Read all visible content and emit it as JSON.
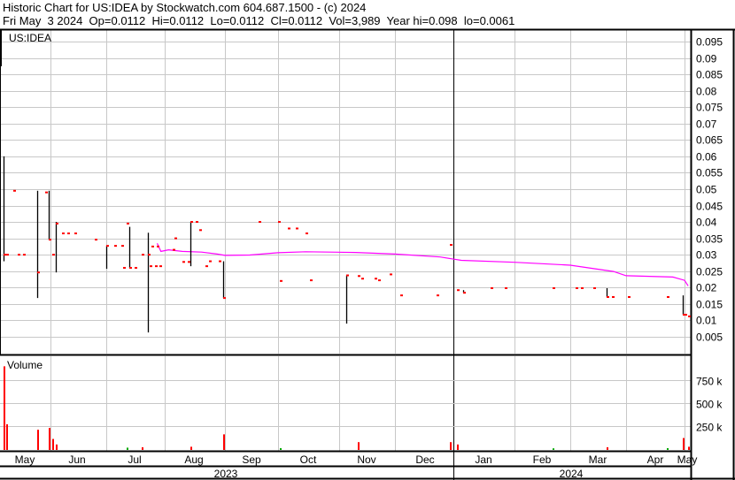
{
  "header": {
    "title": "Historic Chart for US:IDEA by Stockwatch.com 604.687.1500 - (c) 2024",
    "quote": "Fri May  3 2024  Op=0.0112  Hi=0.0112  Lo=0.0112  Cl=0.0112  Vol=3,989  Year hi=0.098  lo=0.0061"
  },
  "colors": {
    "bar": "#000000",
    "close_tick": "#ff0000",
    "moving_average": "#ff00ff",
    "volume_up": "#ff0000",
    "volume_other": "#00aa00",
    "grid": "#c8c8c8"
  },
  "chart_data": [
    {
      "type": "ohlc",
      "title": "US:IDEA",
      "ylim": [
        0,
        0.1
      ],
      "yticks": [
        "0.005",
        "0.01",
        "0.015",
        "0.02",
        "0.025",
        "0.03",
        "0.035",
        "0.04",
        "0.045",
        "0.05",
        "0.055",
        "0.06",
        "0.065",
        "0.07",
        "0.075",
        "0.08",
        "0.085",
        "0.09",
        "0.095"
      ],
      "xticks": [
        "May",
        "Jun",
        "Jul",
        "Aug",
        "Sep",
        "Oct",
        "Nov",
        "Dec",
        "Jan",
        "Feb",
        "Mar",
        "Apr",
        "May"
      ],
      "years": [
        "2023",
        "2024"
      ],
      "bars": [
        [
          "2023-05-03",
          0.06,
          0.028,
          0.03
        ],
        [
          "2023-05-05",
          0.03,
          0.03,
          0.03
        ],
        [
          "2023-05-09",
          0.0495,
          0.0495,
          0.0495
        ],
        [
          "2023-05-12",
          0.03,
          0.03,
          0.03
        ],
        [
          "2023-05-15",
          0.03,
          0.03,
          0.03
        ],
        [
          "2023-05-24",
          0.0495,
          0.0168,
          0.0246
        ],
        [
          "2023-05-29",
          0.049,
          0.049,
          0.049
        ],
        [
          "2023-05-31",
          0.0495,
          0.0346,
          0.0346
        ],
        [
          "2023-06-02",
          0.03,
          0.03,
          0.03
        ],
        [
          "2023-06-04",
          0.04,
          0.0246,
          0.0395
        ],
        [
          "2023-06-07",
          0.0365,
          0.0365,
          0.0365
        ],
        [
          "2023-06-10",
          0.0365,
          0.0365,
          0.0365
        ],
        [
          "2023-06-14",
          0.0365,
          0.0365,
          0.0365
        ],
        [
          "2023-06-25",
          0.0346,
          0.0346,
          0.0346
        ],
        [
          "2023-07-01",
          0.0327,
          0.0257,
          0.0327
        ],
        [
          "2023-07-05",
          0.0327,
          0.0327,
          0.0327
        ],
        [
          "2023-07-09",
          0.0327,
          0.0327,
          0.0327
        ],
        [
          "2023-07-10",
          0.026,
          0.026,
          0.026
        ],
        [
          "2023-07-12",
          0.0395,
          0.0395,
          0.0395
        ],
        [
          "2023-07-13",
          0.0385,
          0.026,
          0.026
        ],
        [
          "2023-07-16",
          0.026,
          0.026,
          0.026
        ],
        [
          "2023-07-20",
          0.03,
          0.03,
          0.03
        ],
        [
          "2023-07-23",
          0.0367,
          0.0063,
          0.03
        ],
        [
          "2023-07-24",
          0.0265,
          0.0265,
          0.0265
        ],
        [
          "2023-07-25",
          0.0325,
          0.0325,
          0.0325
        ],
        [
          "2023-07-27",
          0.0265,
          0.0265,
          0.0265
        ],
        [
          "2023-07-28",
          0.0325,
          0.0325,
          0.0325
        ],
        [
          "2023-07-29",
          0.0265,
          0.0265,
          0.0265
        ],
        [
          "2023-08-05",
          0.0315,
          0.0315,
          0.0315
        ],
        [
          "2023-08-06",
          0.035,
          0.035,
          0.035
        ],
        [
          "2023-08-10",
          0.0278,
          0.0278,
          0.0278
        ],
        [
          "2023-08-13",
          0.0278,
          0.0278,
          0.0278
        ],
        [
          "2023-08-14",
          0.04,
          0.0265,
          0.04
        ],
        [
          "2023-08-17",
          0.04,
          0.04,
          0.04
        ],
        [
          "2023-08-19",
          0.0375,
          0.0375,
          0.0375
        ],
        [
          "2023-08-22",
          0.0265,
          0.0265,
          0.0265
        ],
        [
          "2023-08-24",
          0.028,
          0.028,
          0.028
        ],
        [
          "2023-08-29",
          0.028,
          0.028,
          0.028
        ],
        [
          "2023-08-31",
          0.028,
          0.0168,
          0.0168
        ],
        [
          "2023-09-20",
          0.04,
          0.04,
          0.04
        ],
        [
          "2023-10-01",
          0.04,
          0.04,
          0.04
        ],
        [
          "2023-10-02",
          0.022,
          0.022,
          0.022
        ],
        [
          "2023-10-06",
          0.038,
          0.038,
          0.038
        ],
        [
          "2023-10-10",
          0.038,
          0.038,
          0.038
        ],
        [
          "2023-10-15",
          0.0365,
          0.0365,
          0.0365
        ],
        [
          "2023-10-17",
          0.0222,
          0.0222,
          0.0222
        ],
        [
          "2023-11-05",
          0.0237,
          0.009,
          0.0237
        ],
        [
          "2023-11-11",
          0.0235,
          0.0235,
          0.0235
        ],
        [
          "2023-11-13",
          0.0227,
          0.0227,
          0.0227
        ],
        [
          "2023-11-20",
          0.0227,
          0.0227,
          0.0227
        ],
        [
          "2023-11-22",
          0.0222,
          0.0222,
          0.0222
        ],
        [
          "2023-11-28",
          0.024,
          0.024,
          0.024
        ],
        [
          "2023-12-04",
          0.0176,
          0.0176,
          0.0176
        ],
        [
          "2023-12-23",
          0.0176,
          0.0176,
          0.0176
        ],
        [
          "2023-12-30",
          0.033,
          0.033,
          0.033
        ],
        [
          "2024-01-03",
          0.0192,
          0.0192,
          0.0192
        ],
        [
          "2024-01-06",
          0.0192,
          0.0184,
          0.0184
        ],
        [
          "2024-01-20",
          0.0198,
          0.0198,
          0.0198
        ],
        [
          "2024-01-27",
          0.0198,
          0.0198,
          0.0198
        ],
        [
          "2024-02-21",
          0.0198,
          0.0198,
          0.0198
        ],
        [
          "2024-03-04",
          0.0198,
          0.0198,
          0.0198
        ],
        [
          "2024-03-07",
          0.0198,
          0.0198,
          0.0198
        ],
        [
          "2024-03-14",
          0.0198,
          0.0198,
          0.0198
        ],
        [
          "2024-03-21",
          0.0198,
          0.0171,
          0.0171
        ],
        [
          "2024-03-24",
          0.0171,
          0.0171,
          0.0171
        ],
        [
          "2024-04-02",
          0.0171,
          0.0171,
          0.0171
        ],
        [
          "2024-04-22",
          0.0171,
          0.0171,
          0.0171
        ],
        [
          "2024-04-30",
          0.0176,
          0.0117,
          0.0117
        ],
        [
          "2024-05-01",
          0.0117,
          0.0117,
          0.0117
        ],
        [
          "2024-05-03",
          0.0112,
          0.0112,
          0.0112
        ]
      ],
      "moving_average": [
        [
          "2023-07-28",
          0.0335
        ],
        [
          "2023-07-30",
          0.031
        ],
        [
          "2023-08-03",
          0.0315
        ],
        [
          "2023-08-10",
          0.031
        ],
        [
          "2023-08-20",
          0.0308
        ],
        [
          "2023-08-28",
          0.0302
        ],
        [
          "2023-09-01",
          0.0298
        ],
        [
          "2023-09-15",
          0.0299
        ],
        [
          "2023-10-01",
          0.0306
        ],
        [
          "2023-10-15",
          0.0309
        ],
        [
          "2023-11-10",
          0.0307
        ],
        [
          "2023-12-01",
          0.0302
        ],
        [
          "2023-12-25",
          0.0293
        ],
        [
          "2024-01-05",
          0.0283
        ],
        [
          "2024-02-01",
          0.0277
        ],
        [
          "2024-03-01",
          0.0268
        ],
        [
          "2024-03-25",
          0.0249
        ],
        [
          "2024-04-01",
          0.0236
        ],
        [
          "2024-04-25",
          0.0232
        ],
        [
          "2024-05-01",
          0.0222
        ],
        [
          "2024-05-03",
          0.0205
        ]
      ]
    },
    {
      "type": "bar",
      "title": "Volume",
      "ylim": [
        0,
        950000
      ],
      "yticks": [
        "250 k",
        "500 k",
        "750 k"
      ],
      "values": [
        [
          "2023-05-03",
          900000,
          "up"
        ],
        [
          "2023-05-05",
          270000,
          "up"
        ],
        [
          "2023-05-24",
          210000,
          "up"
        ],
        [
          "2023-05-31",
          230000,
          "up"
        ],
        [
          "2023-06-02",
          110000,
          "up"
        ],
        [
          "2023-06-04",
          50000,
          "up"
        ],
        [
          "2023-07-12",
          15000,
          "other"
        ],
        [
          "2023-07-20",
          20000,
          "up"
        ],
        [
          "2023-08-14",
          25000,
          "up"
        ],
        [
          "2023-08-31",
          160000,
          "up"
        ],
        [
          "2023-10-02",
          10000,
          "other"
        ],
        [
          "2023-11-11",
          75000,
          "up"
        ],
        [
          "2023-12-30",
          75000,
          "up"
        ],
        [
          "2024-01-03",
          50000,
          "up"
        ],
        [
          "2024-02-21",
          8000,
          "other"
        ],
        [
          "2024-03-21",
          20000,
          "up"
        ],
        [
          "2024-04-22",
          10000,
          "other"
        ],
        [
          "2024-04-30",
          120000,
          "up"
        ],
        [
          "2024-05-03",
          25000,
          "up"
        ]
      ]
    }
  ]
}
